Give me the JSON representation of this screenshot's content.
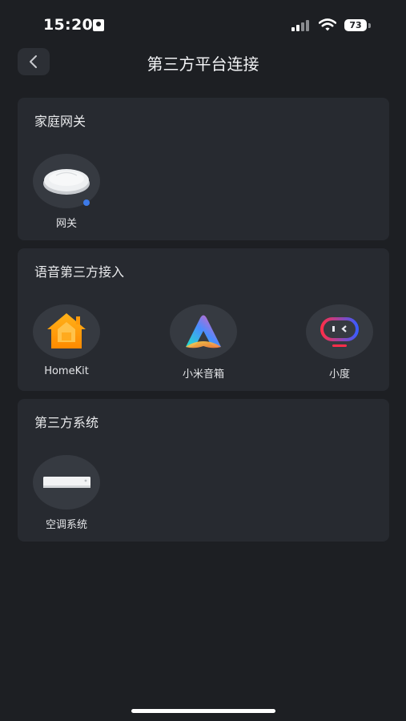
{
  "status": {
    "time": "15:20",
    "battery": "73"
  },
  "header": {
    "title": "第三方平台连接"
  },
  "sections": [
    {
      "title": "家庭网关",
      "items": [
        {
          "label": "网关",
          "icon": "gateway-icon"
        }
      ]
    },
    {
      "title": "语音第三方接入",
      "items": [
        {
          "label": "HomeKit",
          "icon": "homekit-icon"
        },
        {
          "label": "小米音箱",
          "icon": "xiaomi-speaker-icon"
        },
        {
          "label": "小度",
          "icon": "xiaodu-icon"
        }
      ]
    },
    {
      "title": "第三方系统",
      "items": [
        {
          "label": "空调系统",
          "icon": "air-conditioner-icon"
        }
      ]
    }
  ],
  "colors": {
    "background": "#1d1f23",
    "card": "#272a30",
    "icon_circle": "#363a41",
    "status_dot": "#3d7ae8"
  }
}
